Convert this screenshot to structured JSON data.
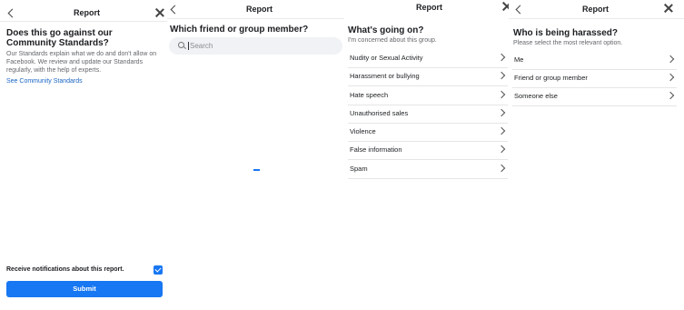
{
  "colors": {
    "accent": "#1877f2",
    "link": "#1a65c5",
    "text": "#1c1e21",
    "muted": "#65676b"
  },
  "panel1": {
    "title": "Report",
    "back_icon": "chevron-left-icon",
    "close_icon": "close-icon",
    "heading": "Does this go against our Community Standards?",
    "description": "Our Standards explain what we do and don't allow on Facebook. We review and update our Standards regularly, with the help of experts.",
    "link": "See Community Standards",
    "notification_label": "Receive notifications about this report.",
    "notification_checked": true,
    "submit_label": "Submit"
  },
  "panel2": {
    "title": "Report",
    "back_icon": "chevron-left-icon",
    "heading": "Which friend or group member?",
    "search_placeholder": "Search",
    "search_icon": "search-icon"
  },
  "panel3": {
    "title": "Report",
    "close_icon": "close-icon",
    "heading": "What's going on?",
    "subheading": "I'm concerned about this group.",
    "options": [
      "Nudity or Sexual Activity",
      "Harassment or bullying",
      "Hate speech",
      "Unauthorised sales",
      "Violence",
      "False information",
      "Spam"
    ]
  },
  "panel4": {
    "title": "Report",
    "back_icon": "chevron-left-icon",
    "close_icon": "close-icon",
    "heading": "Who is being harassed?",
    "subheading": "Please select the most relevant option.",
    "options": [
      "Me",
      "Friend or group member",
      "Someone else"
    ]
  }
}
